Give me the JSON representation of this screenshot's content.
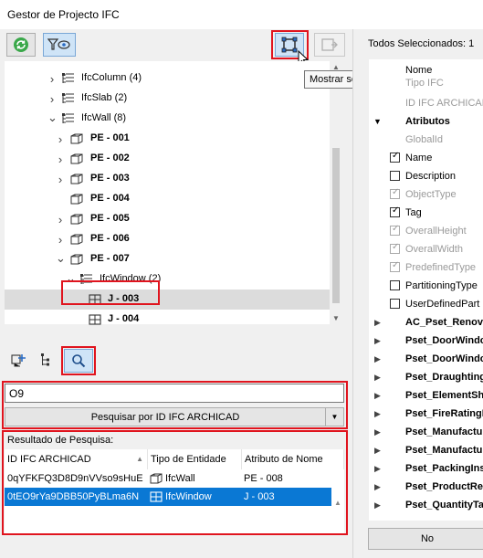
{
  "window": {
    "title": "Gestor de Projecto IFC"
  },
  "toolbar": {
    "tooltip": "Mostrar selecção de lista no modelo"
  },
  "tree": {
    "items": [
      {
        "label": "IfcColumn (4)",
        "type": "ifc-folder",
        "bold": false,
        "chev": "›"
      },
      {
        "label": "IfcSlab (2)",
        "type": "ifc-folder",
        "bold": false,
        "chev": "›"
      },
      {
        "label": "IfcWall (8)",
        "type": "ifc-folder",
        "bold": false,
        "chev": "⌄"
      },
      {
        "label": "PE - 001",
        "type": "wall",
        "bold": true,
        "chev": "›"
      },
      {
        "label": "PE - 002",
        "type": "wall",
        "bold": true,
        "chev": "›"
      },
      {
        "label": "PE - 003",
        "type": "wall",
        "bold": true,
        "chev": "›"
      },
      {
        "label": "PE - 004",
        "type": "wall",
        "bold": true,
        "chev": ""
      },
      {
        "label": "PE - 005",
        "type": "wall",
        "bold": true,
        "chev": "›"
      },
      {
        "label": "PE - 006",
        "type": "wall",
        "bold": true,
        "chev": "›"
      },
      {
        "label": "PE - 007",
        "type": "wall",
        "bold": true,
        "chev": "⌄"
      },
      {
        "label": "IfcWindow (2)",
        "type": "ifc-folder",
        "bold": false,
        "chev": "⌄"
      },
      {
        "label": "J - 003",
        "type": "window",
        "bold": true,
        "chev": ""
      },
      {
        "label": "J - 004",
        "type": "window",
        "bold": true,
        "chev": ""
      }
    ]
  },
  "search": {
    "value": "O9",
    "mode_label": "Pesquisar por ID IFC ARCHICAD",
    "results_label": "Resultado de Pesquisa:",
    "columns": [
      "ID IFC ARCHICAD",
      "Tipo de Entidade",
      "Atributo de Nome"
    ],
    "rows": [
      {
        "id": "0qYFKFQ3D8D9nVVso9sHuE",
        "entity": "IfcWall",
        "name": "PE - 008"
      },
      {
        "id": "0tEO9rYa9DBB50PyBLma6N",
        "entity": "IfcWindow",
        "name": "J - 003"
      }
    ]
  },
  "properties": {
    "header": "Todos Seleccionados: 1",
    "col_name": "Nome",
    "cut_row": "Tipo IFC",
    "id_row": "ID IFC ARCHICAD",
    "attributes_label": "Atributos",
    "global_id": "GlobalId",
    "attrs": [
      {
        "label": "Name",
        "checked": true,
        "disabled": false
      },
      {
        "label": "Description",
        "checked": false,
        "disabled": false
      },
      {
        "label": "ObjectType",
        "checked": true,
        "disabled": true
      },
      {
        "label": "Tag",
        "checked": true,
        "disabled": false
      },
      {
        "label": "OverallHeight",
        "checked": true,
        "disabled": true
      },
      {
        "label": "OverallWidth",
        "checked": true,
        "disabled": true
      },
      {
        "label": "PredefinedType",
        "checked": true,
        "disabled": true
      },
      {
        "label": "PartitioningType",
        "checked": false,
        "disabled": false
      },
      {
        "label": "UserDefinedPart",
        "checked": false,
        "disabled": false
      }
    ],
    "psets": [
      "AC_Pset_Renova",
      "Pset_DoorWindo",
      "Pset_DoorWindo",
      "Pset_Draughting",
      "Pset_ElementSha",
      "Pset_FireRatingP",
      "Pset_Manufactur",
      "Pset_Manufactur",
      "Pset_PackingInst",
      "Pset_ProductReq",
      "Pset_QuantityTak"
    ],
    "bottom_button": "No"
  }
}
